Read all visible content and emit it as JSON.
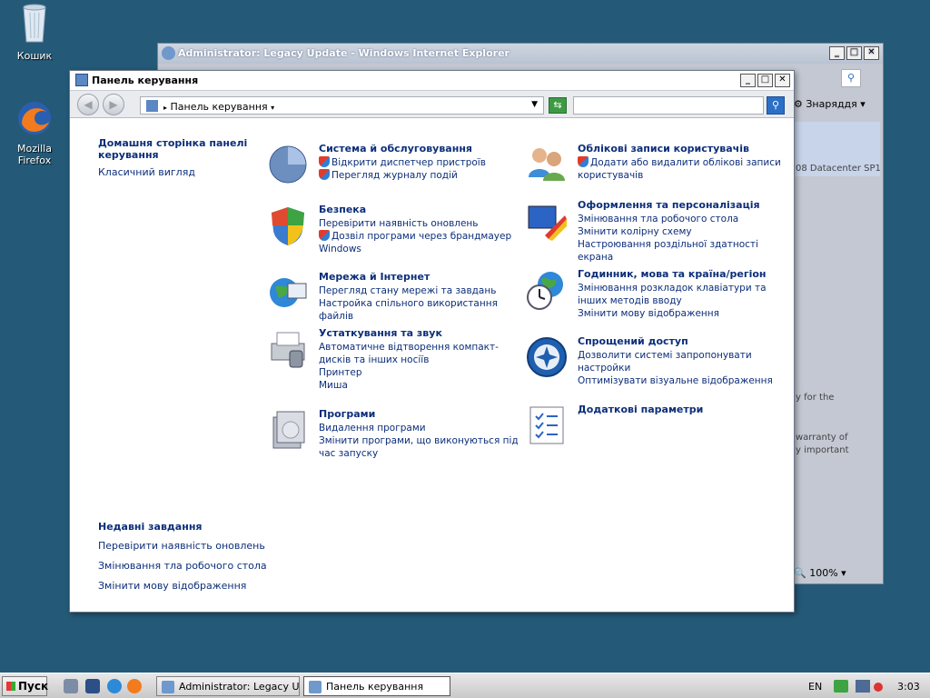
{
  "desktop": {
    "icons": [
      {
        "label": "Кошик",
        "icon": "recycle-bin-icon"
      },
      {
        "label": "Mozilla Firefox",
        "icon": "firefox-icon"
      }
    ]
  },
  "ie_window": {
    "title": "Administrator: Legacy Update - Windows Internet Explorer",
    "tools_label": "Знаряддя",
    "zoom": "100%",
    "partial_text": [
      "08 Datacenter SP1",
      "y for the",
      "warranty of",
      "y important"
    ]
  },
  "cp_window": {
    "title": "Панель керування",
    "address": "Панель керування",
    "search_placeholder": ""
  },
  "sidebar": {
    "home_link": "Домашня сторінка панелі керування",
    "classic_view": "Класичний вигляд",
    "recent_title": "Недавні завдання",
    "recent": [
      "Перевірити наявність оновлень",
      "Змінювання тла робочого стола",
      "Змінити мову відображення"
    ]
  },
  "categories": {
    "system": {
      "title": "Система й обслуговування",
      "links": [
        "Відкрити диспетчер пристроїв",
        "Перегляд журналу подій"
      ]
    },
    "security": {
      "title": "Безпека",
      "links": [
        "Перевірити наявність оновлень",
        "Дозвіл програми через брандмауер Windows"
      ]
    },
    "network": {
      "title": "Мережа й Інтернет",
      "links": [
        "Перегляд стану мережі та завдань",
        "Настройка спільного використання файлів"
      ]
    },
    "hardware": {
      "title": "Устаткування та звук",
      "links": [
        "Автоматичне відтворення компакт-дисків та інших носіїв",
        "Принтер",
        "Миша"
      ]
    },
    "programs": {
      "title": "Програми",
      "links": [
        "Видалення програми",
        "Змінити програми, що виконуються під час запуску"
      ]
    },
    "accounts": {
      "title": "Облікові записи користувачів",
      "links": [
        "Додати або видалити облікові записи користувачів"
      ]
    },
    "appearance": {
      "title": "Оформлення та персоналізація",
      "links": [
        "Змінювання тла робочого стола",
        "Змінити колірну схему",
        "Настроювання роздільної здатності екрана"
      ]
    },
    "clock": {
      "title": "Годинник, мова та країна/регіон",
      "links": [
        "Змінювання розкладок клавіатури та інших методів вводу",
        "Змінити мову відображення"
      ]
    },
    "access": {
      "title": "Спрощений доступ",
      "links": [
        "Дозволити системі запропонувати настройки",
        "Оптимізувати візуальне відображення"
      ]
    },
    "additional": {
      "title": "Додаткові параметри"
    }
  },
  "taskbar": {
    "start": "Пуск",
    "tasks": [
      "Administrator: Legacy U...",
      "Панель керування"
    ],
    "lang": "EN",
    "time": "3:03"
  }
}
